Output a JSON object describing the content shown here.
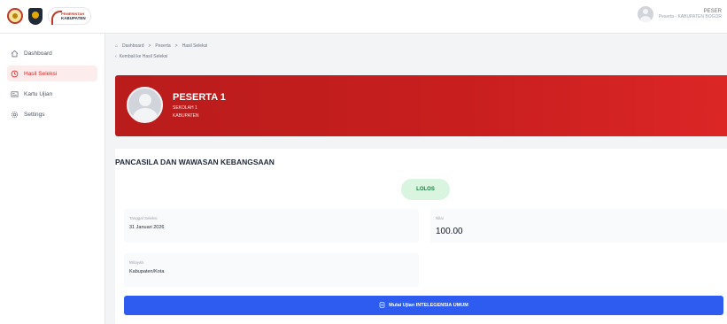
{
  "header": {
    "brand_line1": "PEMERINTAH",
    "brand_line2": "KABUPATEN",
    "user_name": "PESER",
    "user_role": "Peserta - KABUPATEN BOGOR"
  },
  "sidebar": {
    "items": [
      {
        "label": "Dashboard",
        "icon": "home-icon",
        "active": false
      },
      {
        "label": "Hasil Seleksi",
        "icon": "clock-icon",
        "active": true
      },
      {
        "label": "Kartu Ujian",
        "icon": "id-card-icon",
        "active": false
      },
      {
        "label": "Settings",
        "icon": "gear-icon",
        "active": false
      }
    ]
  },
  "breadcrumb": {
    "items": [
      "Dashboard",
      "Peserta",
      "Hasil Seleksi"
    ],
    "separator": ">"
  },
  "back_link": "Kembali ke Hasil Seleksi",
  "hero": {
    "name": "PESERTA 1",
    "school": "SEKOLAH 1",
    "district": "KABUPATEN"
  },
  "result": {
    "subject": "PANCASILA DAN WAWASAN KEBANGSAAN",
    "status": "LOLOS",
    "date_label": "Tanggal Seleksi",
    "date_value": "31 Januari 2026",
    "score_label": "Nilai",
    "score_value": "100.00",
    "region_label": "Wilayah",
    "region_value": "Kabupaten/Kota"
  },
  "action": {
    "start_label": "Mulai Ujian INTELEGENSIA UMUM"
  },
  "colors": {
    "accent_red": "#c81e1e",
    "button_blue": "#2f5cf0",
    "status_green": "#15803d"
  }
}
